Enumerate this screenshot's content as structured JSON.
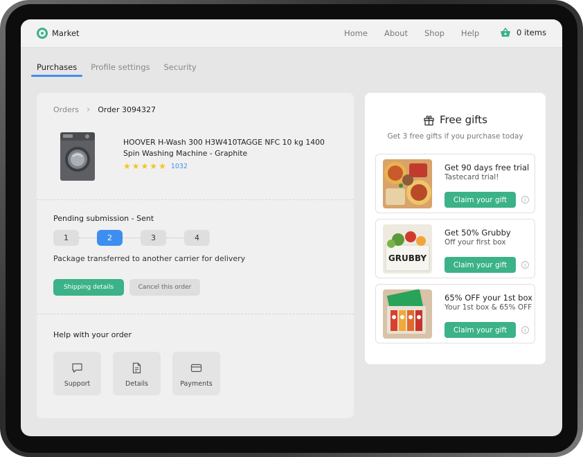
{
  "header": {
    "brand": "Market",
    "nav": [
      "Home",
      "About",
      "Shop",
      "Help"
    ],
    "cart_text": "0 items"
  },
  "tabs": [
    {
      "label": "Purchases",
      "active": true
    },
    {
      "label": "Profile settings",
      "active": false
    },
    {
      "label": "Security",
      "active": false
    }
  ],
  "order": {
    "breadcrumb_root": "Orders",
    "breadcrumb_current": "Order 3094327",
    "product_title": "HOOVER H-Wash 300 H3W410TAGGE NFC 10 kg 1400 Spin Washing Machine - Graphite",
    "rating_stars": 5,
    "review_count": "1032",
    "status_title": "Pending submission - Sent",
    "steps": [
      "1",
      "2",
      "3",
      "4"
    ],
    "active_step": 2,
    "status_message": "Package transferred to another carrier for delivery",
    "btn_shipping": "Shipping details",
    "btn_cancel": "Cancel this order",
    "help_title": "Help with your order",
    "help_items": [
      {
        "label": "Support",
        "icon": "chat-icon"
      },
      {
        "label": "Details",
        "icon": "document-icon"
      },
      {
        "label": "Payments",
        "icon": "card-icon"
      }
    ]
  },
  "gifts": {
    "title": "Free gifts",
    "subtitle": "Get 3 free gifts if you purchase today",
    "items": [
      {
        "title": "Get 90 days free trial",
        "subtitle": "Tastecard trial!",
        "button": "Claim your gift"
      },
      {
        "title": "Get 50% Grubby",
        "subtitle": "Off your first box",
        "button": "Claim your gift",
        "image_text": "GRUBBY"
      },
      {
        "title": "65% OFF your 1st box",
        "subtitle": "Your 1st box & 65% OFF",
        "button": "Claim your gift"
      }
    ]
  },
  "colors": {
    "accent_green": "#3bb287",
    "accent_blue": "#3d8ef0",
    "star": "#f5c518"
  }
}
